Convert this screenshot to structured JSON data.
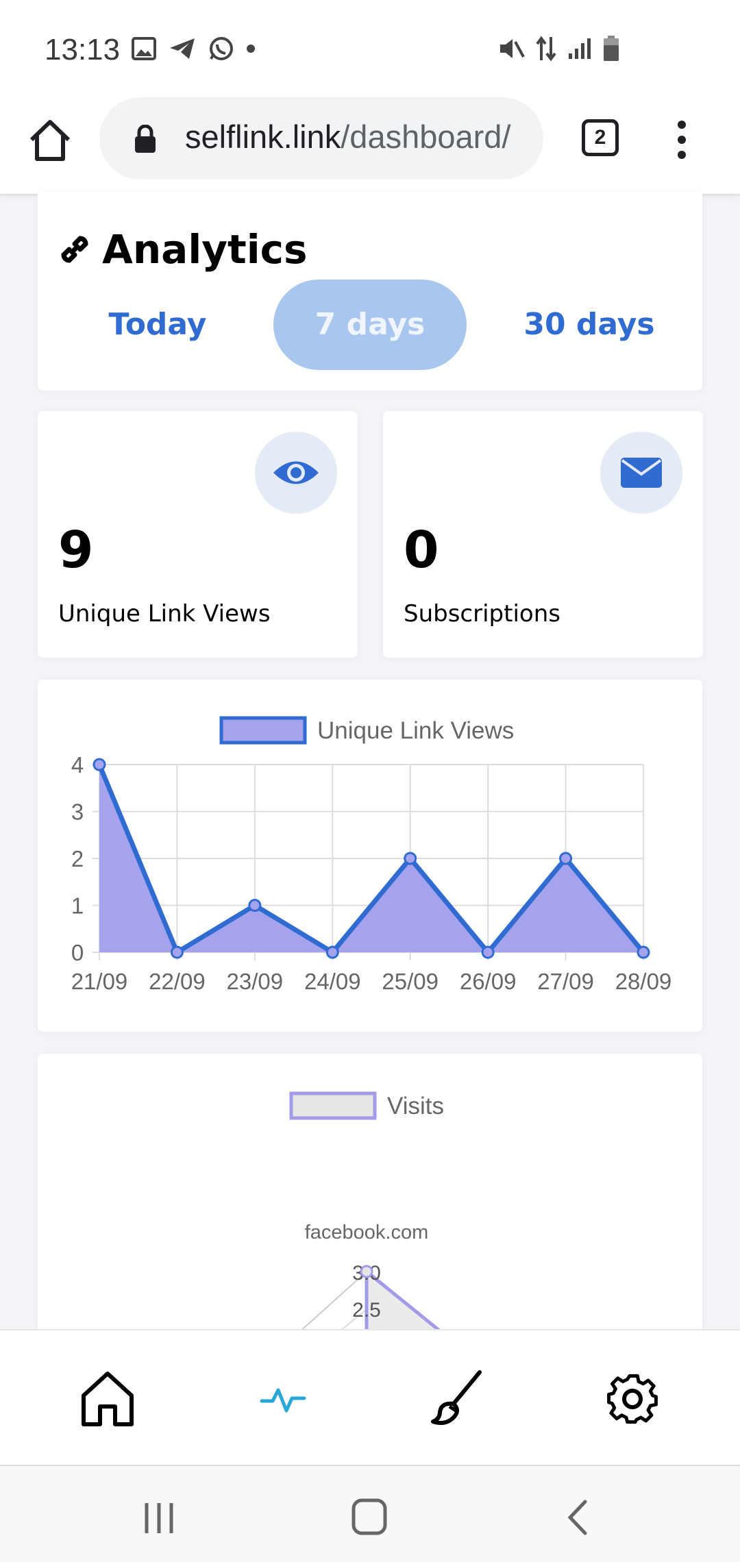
{
  "status_bar": {
    "time": "13:13",
    "left_icons": [
      "gallery-icon",
      "telegram-icon",
      "whatsapp-icon",
      "dot-icon"
    ],
    "right_icons": [
      "mute-icon",
      "data-arrows-icon",
      "signal-icon",
      "battery-icon"
    ]
  },
  "browser": {
    "url_host": "selflink.link",
    "url_path": "/dashboard/",
    "tab_count": "2"
  },
  "analytics": {
    "title": "Analytics",
    "periods": [
      {
        "label": "Today",
        "active": false
      },
      {
        "label": "7 days",
        "active": true
      },
      {
        "label": "30 days",
        "active": false
      }
    ]
  },
  "stats": [
    {
      "value": "9",
      "label": "Unique Link Views",
      "icon": "eye-icon"
    },
    {
      "value": "0",
      "label": "Subscriptions",
      "icon": "envelope-icon"
    }
  ],
  "chart_data": [
    {
      "type": "area",
      "legend": "Unique Link Views",
      "categories": [
        "21/09",
        "22/09",
        "23/09",
        "24/09",
        "25/09",
        "26/09",
        "27/09",
        "28/09"
      ],
      "series": [
        {
          "name": "Unique Link Views",
          "values": [
            4,
            0,
            1,
            0,
            2,
            0,
            2,
            0
          ]
        }
      ],
      "ylim": [
        0,
        4
      ],
      "yticks": [
        "0",
        "1",
        "2",
        "3",
        "4"
      ],
      "grid": true,
      "legend_position": "top",
      "line_color": "#2f6bd1",
      "fill_color": "#a5a3ee"
    },
    {
      "type": "radar",
      "legend": "Visits",
      "point_label": "facebook.com",
      "rticks": [
        "3.0",
        "2.5"
      ],
      "series": [
        {
          "name": "Visits",
          "values": [
            3
          ]
        }
      ],
      "legend_position": "top",
      "line_color": "#a29be8",
      "fill_color": "#e6e6e6"
    }
  ],
  "app_nav": [
    {
      "name": "home",
      "icon": "home-icon",
      "active": false
    },
    {
      "name": "analytics",
      "icon": "pulse-icon",
      "active": true
    },
    {
      "name": "design",
      "icon": "brush-icon",
      "active": false
    },
    {
      "name": "settings",
      "icon": "gear-icon",
      "active": false
    }
  ],
  "colors": {
    "accent": "#2f6bd1",
    "active_pill": "#a9c6ee",
    "nav_active": "#27a6d9"
  }
}
